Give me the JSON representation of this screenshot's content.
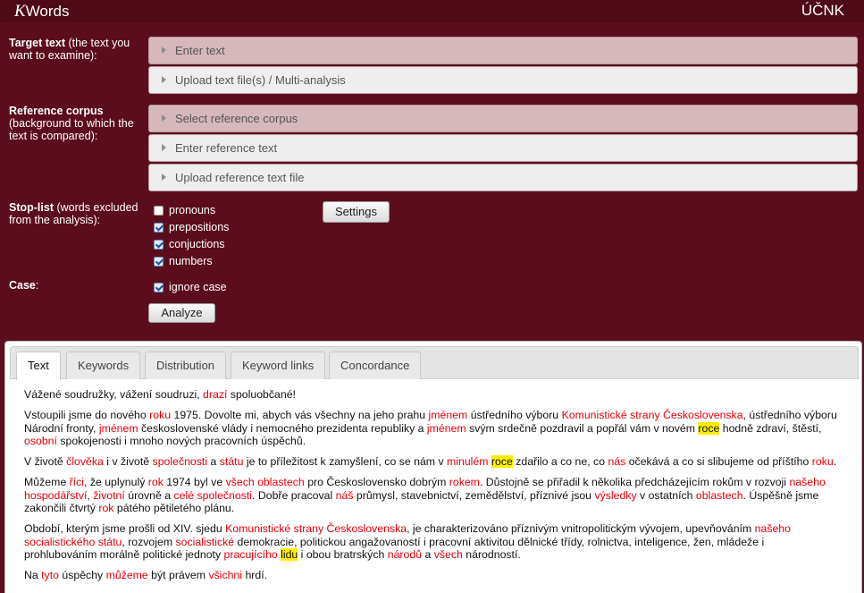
{
  "app": {
    "logo_k": "K",
    "logo_rest": "Words",
    "institute": "ÚČNK"
  },
  "target": {
    "label_bold": "Target text",
    "label_rest": " (the text you want to examine):",
    "enter": "Enter text",
    "upload": "Upload text file(s) / Multi-analysis"
  },
  "reference": {
    "label_bold": "Reference corpus",
    "label_rest": " (background to which the text is compared):",
    "select": "Select reference corpus",
    "enter": "Enter reference text",
    "upload": "Upload reference text file"
  },
  "stoplist": {
    "label_bold": "Stop-list",
    "label_rest": " (words excluded from the analysis):",
    "items": [
      {
        "label": "pronouns",
        "checked": false
      },
      {
        "label": "prepositions",
        "checked": true
      },
      {
        "label": "conjuctions",
        "checked": true
      },
      {
        "label": "numbers",
        "checked": true
      }
    ],
    "settings": "Settings"
  },
  "case": {
    "label_bold": "Case",
    "label_rest": ":",
    "ignore": "ignore case",
    "checked": true
  },
  "analyze": "Analyze",
  "tabs": [
    "Text",
    "Keywords",
    "Distribution",
    "Keyword links",
    "Concordance"
  ],
  "active_tab": 0,
  "colors": {
    "keyword": "#e0000b",
    "highlight": "#ffee00"
  },
  "paragraphs": [
    [
      [
        "Vážené soudružky, vážení soudruzi, ",
        ""
      ],
      [
        "drazí",
        "kw"
      ],
      [
        " spoluobčané!",
        ""
      ]
    ],
    [
      [
        "Vstoupili jsme do nového ",
        ""
      ],
      [
        "roku",
        "kw"
      ],
      [
        " 1975. Dovolte mi, abych vás všechny na jeho prahu ",
        ""
      ],
      [
        "jménem",
        "kw"
      ],
      [
        " ústředního výboru ",
        ""
      ],
      [
        "Komunistické strany Československa",
        "kw"
      ],
      [
        ", ústředního výboru Národní fronty, ",
        ""
      ],
      [
        "jménem",
        "kw"
      ],
      [
        " československé vlády i nemocného prezidenta republiky a ",
        ""
      ],
      [
        "jménem",
        "kw"
      ],
      [
        " svým srdečně pozdravil a popřál vám v novém ",
        ""
      ],
      [
        "roce",
        "hl"
      ],
      [
        " hodně zdraví, štěstí, ",
        ""
      ],
      [
        "osobní",
        "kw"
      ],
      [
        " spokojenosti i mnoho nových pracovních úspěchů.",
        ""
      ]
    ],
    [
      [
        "V životě ",
        ""
      ],
      [
        "člověka",
        "kw"
      ],
      [
        " i v životě ",
        ""
      ],
      [
        "společnosti",
        "kw"
      ],
      [
        " a ",
        ""
      ],
      [
        "státu",
        "kw"
      ],
      [
        " je to příležitost k zamyšlení, co se nám v ",
        ""
      ],
      [
        "minulém",
        "kw"
      ],
      [
        " ",
        ""
      ],
      [
        "roce",
        "hl"
      ],
      [
        " zdařilo a co ne, co ",
        ""
      ],
      [
        "nás",
        "kw"
      ],
      [
        " očekává a co si slibujeme od příštího ",
        ""
      ],
      [
        "roku",
        "kw"
      ],
      [
        ".",
        ""
      ]
    ],
    [
      [
        "Můžeme ",
        ""
      ],
      [
        "říci",
        "kw"
      ],
      [
        ", že uplynulý ",
        ""
      ],
      [
        "rok",
        "kw"
      ],
      [
        " 1974 byl ve ",
        ""
      ],
      [
        "všech oblastech",
        "kw"
      ],
      [
        " pro Československo dobrým ",
        ""
      ],
      [
        "rokem",
        "kw"
      ],
      [
        ". Důstojně se přiřadil k několika předcházejícím rokům v rozvoji ",
        ""
      ],
      [
        "našeho hospodářství",
        "kw"
      ],
      [
        ", ",
        ""
      ],
      [
        "životní",
        "kw"
      ],
      [
        " úrovně a ",
        ""
      ],
      [
        "celé společnosti",
        "kw"
      ],
      [
        ". Dobře pracoval ",
        ""
      ],
      [
        "náš",
        "kw"
      ],
      [
        " průmysl, stavebnictví, zemědělství, příznivé jsou ",
        ""
      ],
      [
        "výsledky",
        "kw"
      ],
      [
        " v ostatních ",
        ""
      ],
      [
        "oblastech",
        "kw"
      ],
      [
        ". Úspěšně jsme zakončili čtvrtý ",
        ""
      ],
      [
        "rok",
        "kw"
      ],
      [
        " pátého pětiletého plánu.",
        ""
      ]
    ],
    [
      [
        "Období, kterým jsme prošli od XIV. sjedu ",
        ""
      ],
      [
        "Komunistické strany Československa",
        "kw"
      ],
      [
        ", je charakterizováno příznivým vnitropolitickým vývojem, upevňováním ",
        ""
      ],
      [
        "našeho socialistického státu",
        "kw"
      ],
      [
        ", rozvojem ",
        ""
      ],
      [
        "socialistické",
        "kw"
      ],
      [
        " demokracie, politickou angažovaností i pracovní aktivitou dělnické třídy, rolnictva, inteligence, žen, mládeže i prohlubováním morálně politické jednoty ",
        ""
      ],
      [
        "pracujícího",
        "kw"
      ],
      [
        " ",
        ""
      ],
      [
        "lidu",
        "hl"
      ],
      [
        " i obou bratrských ",
        ""
      ],
      [
        "národů",
        "kw"
      ],
      [
        " a ",
        ""
      ],
      [
        "všech",
        "kw"
      ],
      [
        " národností.",
        ""
      ]
    ],
    [
      [
        "Na ",
        ""
      ],
      [
        "tyto",
        "kw"
      ],
      [
        " úspěchy ",
        ""
      ],
      [
        "můžeme",
        "kw"
      ],
      [
        " být právem ",
        ""
      ],
      [
        "všichni",
        "kw"
      ],
      [
        " hrdí.",
        ""
      ]
    ]
  ]
}
